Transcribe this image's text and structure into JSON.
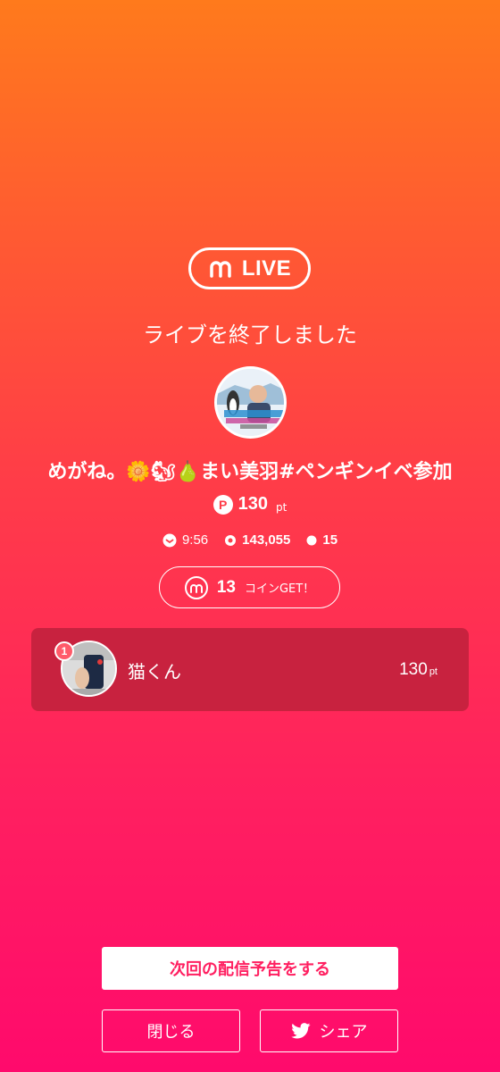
{
  "badge": {
    "icon": "m-logo-icon",
    "label": "LIVE"
  },
  "status_text": "ライブを終了しました",
  "streamer": {
    "name": "めがね。🌼🐿🍐まい美羽#ペンギンイベ参加"
  },
  "points": {
    "icon_letter": "P",
    "value": "130",
    "unit": "pt"
  },
  "stats": {
    "duration": "9:56",
    "viewers": "143,055",
    "comments": "15"
  },
  "coins": {
    "value": "13",
    "label": "コインGET！"
  },
  "ranking": [
    {
      "rank": "1",
      "name": "猫くん",
      "points": "130",
      "unit": "pt"
    }
  ],
  "buttons": {
    "schedule": "次回の配信予告をする",
    "close": "閉じる",
    "share": "シェア"
  },
  "colors": {
    "gradient_top": "#ff7a1c",
    "gradient_bottom": "#ff0a6c",
    "card": "#c8223f",
    "accent": "#ff1f60"
  }
}
